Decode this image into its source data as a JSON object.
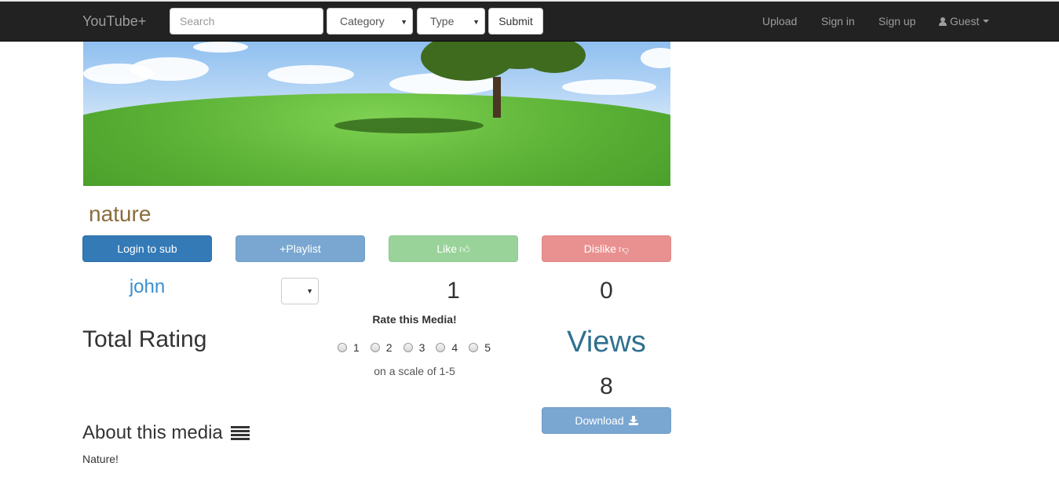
{
  "navbar": {
    "brand": "YouTube+",
    "search_placeholder": "Search",
    "category_label": "Category",
    "type_label": "Type",
    "submit_label": "Submit",
    "links": {
      "upload": "Upload",
      "signin": "Sign in",
      "signup": "Sign up",
      "guest": "Guest"
    }
  },
  "media": {
    "title": "nature",
    "uploader": "john",
    "likes": "1",
    "dislikes": "0",
    "views_label": "Views",
    "views": "8",
    "description_heading": "About this media",
    "description": "Nature!"
  },
  "actions": {
    "subscribe": "Login to sub",
    "playlist": "+Playlist",
    "like": "Like",
    "dislike": "Dislike",
    "download": "Download"
  },
  "rating": {
    "total_label": "Total Rating",
    "heading": "Rate this Media!",
    "options": [
      "1",
      "2",
      "3",
      "4",
      "5"
    ],
    "scale_text": "on a scale of 1-5"
  },
  "colors": {
    "navbar_bg": "#222222",
    "primary": "#337ab7",
    "playlist": "#7aa7d2",
    "like": "#9ad39a",
    "dislike": "#e99190",
    "title": "#8a6d3b",
    "link": "#3a8fd0",
    "views": "#31708f"
  },
  "icons": [
    "user-icon",
    "caret-down-icon",
    "thumbs-up-icon",
    "thumbs-down-icon",
    "download-icon",
    "list-icon"
  ]
}
